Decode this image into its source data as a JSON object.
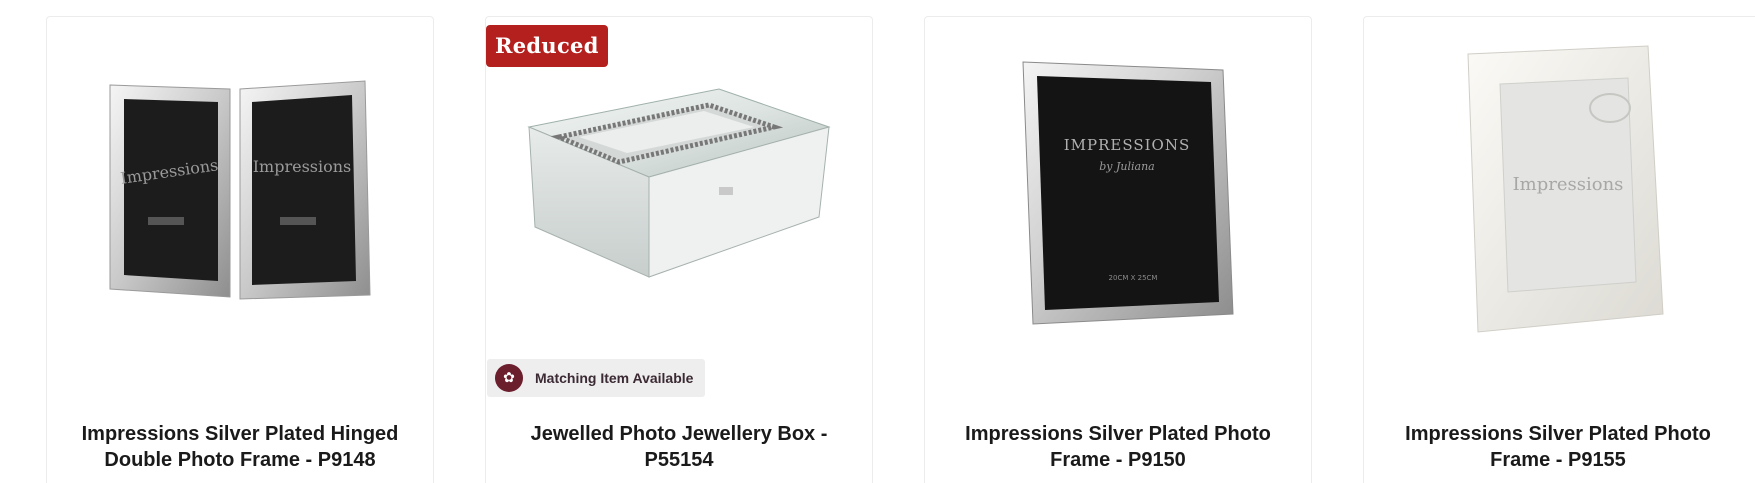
{
  "products": [
    {
      "title": "Impressions Silver Plated Hinged Double Photo Frame - P9148",
      "image_label": "Impressions",
      "badge": "",
      "matching": ""
    },
    {
      "title": "Jewelled Photo Jewellery Box - P55154",
      "image_label": "",
      "badge": "Reduced",
      "matching": "Matching Item Available"
    },
    {
      "title": "Impressions Silver Plated Photo Frame - P9150",
      "image_label": "IMPRESSIONS",
      "image_sublabel": "by Juliana",
      "image_size": "20CM X 25CM",
      "badge": "",
      "matching": ""
    },
    {
      "title": "Impressions Silver Plated Photo Frame - P9155",
      "image_label": "Impressions",
      "badge": "",
      "matching": ""
    }
  ],
  "colors": {
    "badge_bg": "#b3201e",
    "matching_bg": "#eeeeee",
    "seal": "#6b1e2c",
    "title_text": "#1a1a1a"
  },
  "icons": {
    "seal": "matching-seal-icon"
  }
}
